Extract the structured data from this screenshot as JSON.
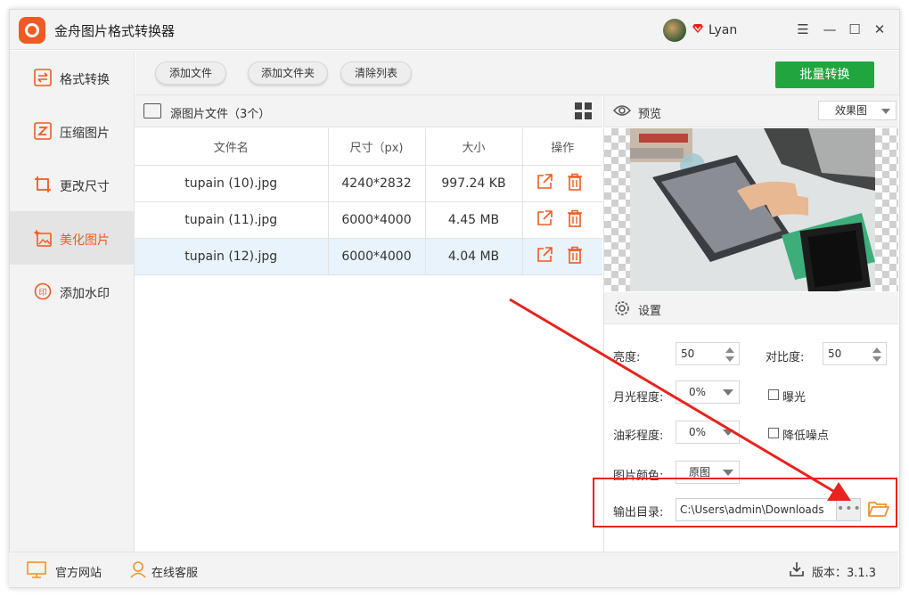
{
  "app": {
    "title": "金舟图片格式转换器",
    "username": "Lyan"
  },
  "window_controls": {
    "menu": "☰",
    "minimize": "—",
    "maximize": "☐",
    "close": "✕"
  },
  "sidebar": {
    "items": [
      {
        "label": "格式转换",
        "icon": "swap-icon"
      },
      {
        "label": "压缩图片",
        "icon": "compress-icon"
      },
      {
        "label": "更改尺寸",
        "icon": "crop-icon"
      },
      {
        "label": "美化图片",
        "icon": "beautify-icon",
        "active": true
      },
      {
        "label": "添加水印",
        "icon": "watermark-icon"
      }
    ]
  },
  "toolbar": {
    "add_file": "添加文件",
    "add_folder": "添加文件夹",
    "clear_list": "清除列表",
    "batch_convert": "批量转换"
  },
  "file_panel": {
    "title": "源图片文件（3个）",
    "columns": [
      "文件名",
      "尺寸（px)",
      "大小",
      "操作"
    ],
    "rows": [
      {
        "name": "tupain (10).jpg",
        "size": "4240*2832",
        "filesize": "997.24 KB"
      },
      {
        "name": "tupain (11).jpg",
        "size": "6000*4000",
        "filesize": "4.45 MB"
      },
      {
        "name": "tupain (12).jpg",
        "size": "6000*4000",
        "filesize": "4.04 MB",
        "selected": true
      }
    ]
  },
  "preview": {
    "label": "预览",
    "mode": "效果图"
  },
  "settings": {
    "label": "设置",
    "brightness_label": "亮度:",
    "brightness_value": "50",
    "contrast_label": "对比度:",
    "contrast_value": "50",
    "moonlight_label": "月光程度:",
    "moonlight_value": "0%",
    "exposure_label": "曝光",
    "oil_label": "油彩程度:",
    "oil_value": "0%",
    "denoise_label": "降低噪点",
    "color_label": "图片颜色:",
    "color_value": "原图",
    "output_label": "输出目录:",
    "output_path": "C:\\Users\\admin\\Downloads",
    "more": "•••"
  },
  "footer": {
    "website": "官方网站",
    "service": "在线客服",
    "version": "版本：3.1.3"
  },
  "colors": {
    "accent": "#f05a22",
    "primary_green": "#21a63f",
    "annotation_red": "#e8231e"
  }
}
